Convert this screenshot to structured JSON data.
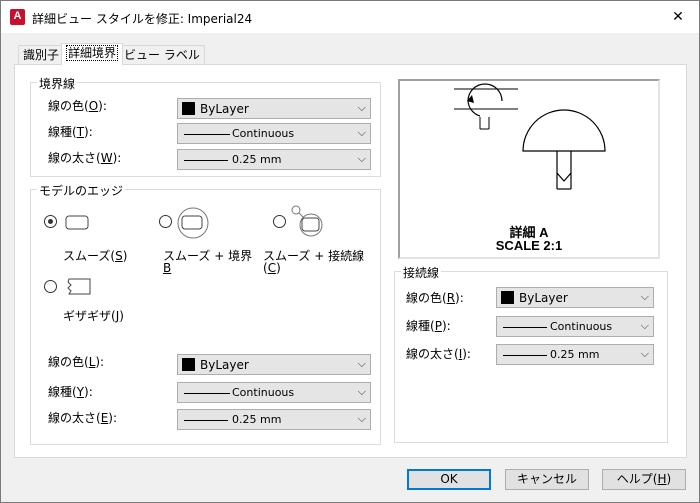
{
  "window": {
    "title": "詳細ビュー スタイルを修正: Imperial24",
    "app_icon_letter": "A",
    "close_glyph": "✕"
  },
  "tabs": [
    {
      "label": "識別子",
      "active": false
    },
    {
      "label": "詳細境界",
      "active": true
    },
    {
      "label": "ビュー ラベル",
      "active": false
    }
  ],
  "boundary": {
    "title": "境界線",
    "color_label_pre": "線の色(",
    "color_key": "O",
    "color_label_post": "):",
    "linetype_label_pre": "線種(",
    "linetype_key": "T",
    "linetype_label_post": "):",
    "lineweight_label_pre": "線の太さ(",
    "lineweight_key": "W",
    "lineweight_label_post": "):",
    "color_value": "ByLayer",
    "linetype_value": "Continuous",
    "lineweight_value": "0.25  mm"
  },
  "model_edge": {
    "title": "モデルのエッジ",
    "options": [
      {
        "label_pre": "スムーズ(",
        "key": "S",
        "label_post": ")",
        "checked": true
      },
      {
        "label_pre": "スムーズ + 境界",
        "key": "B",
        "label_post": "",
        "checked": false
      },
      {
        "label_pre": "スムーズ + 接続線(",
        "key": "C",
        "label_post": ")",
        "checked": false
      },
      {
        "label_pre": "ギザギザ(",
        "key": "J",
        "label_post": ")",
        "checked": false
      }
    ],
    "color_label_pre": "線の色(",
    "color_key": "L",
    "color_label_post": "):",
    "linetype_label_pre": "線種(",
    "linetype_key": "Y",
    "linetype_label_post": "):",
    "lineweight_label_pre": "線の太さ(",
    "lineweight_key": "E",
    "lineweight_label_post": "):",
    "color_value": "ByLayer",
    "linetype_value": "Continuous",
    "lineweight_value": "0.25  mm"
  },
  "preview": {
    "label_line1": "詳細 A",
    "label_line2": "SCALE 2:1"
  },
  "connection": {
    "title": "接続線",
    "color_label_pre": "線の色(",
    "color_key": "R",
    "color_label_post": "):",
    "linetype_label_pre": "線種(",
    "linetype_key": "P",
    "linetype_label_post": "):",
    "lineweight_label_pre": "線の太さ(",
    "lineweight_key": "I",
    "lineweight_label_post": "):",
    "color_value": "ByLayer",
    "linetype_value": "Continuous",
    "lineweight_value": "0.25  mm"
  },
  "buttons": {
    "ok": "OK",
    "cancel": "キャンセル",
    "help_pre": "ヘルプ(",
    "help_key": "H",
    "help_post": ")"
  }
}
